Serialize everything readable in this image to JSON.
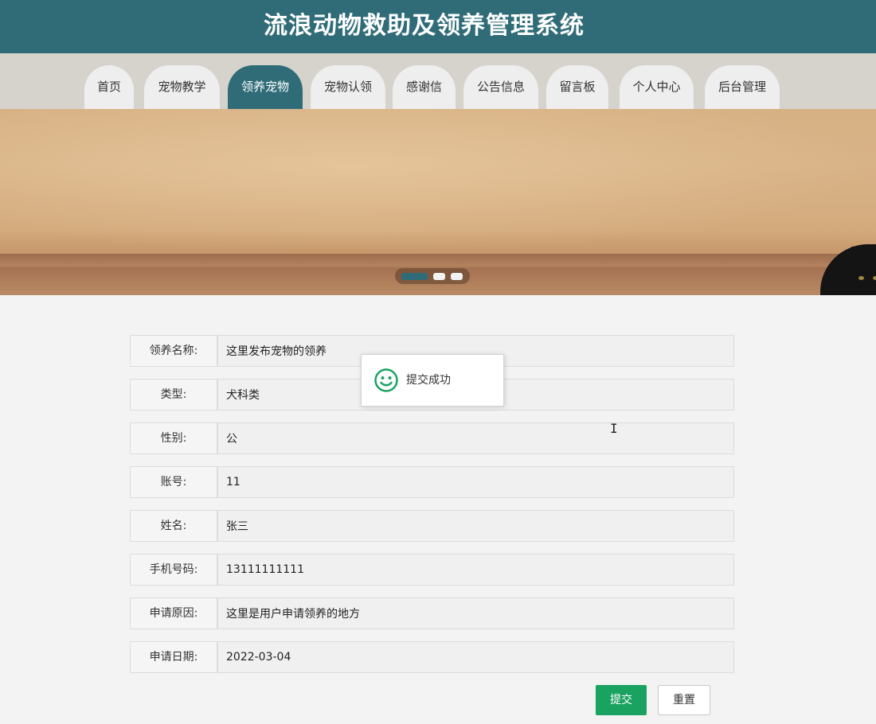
{
  "header": {
    "title": "流浪动物救助及领养管理系统"
  },
  "nav": {
    "items": [
      {
        "label": "首页"
      },
      {
        "label": "宠物教学"
      },
      {
        "label": "领养宠物"
      },
      {
        "label": "宠物认领"
      },
      {
        "label": "感谢信"
      },
      {
        "label": "公告信息"
      },
      {
        "label": "留言板"
      },
      {
        "label": "个人中心"
      },
      {
        "label": "后台管理"
      }
    ],
    "active_index": 2
  },
  "banner": {
    "slide_count": 3,
    "active_slide": 1
  },
  "form": {
    "fields": [
      {
        "label": "领养名称:",
        "value": "这里发布宠物的领养"
      },
      {
        "label": "类型:",
        "value": "犬科类"
      },
      {
        "label": "性别:",
        "value": "公"
      },
      {
        "label": "账号:",
        "value": "11"
      },
      {
        "label": "姓名:",
        "value": "张三"
      },
      {
        "label": "手机号码:",
        "value": "13111111111"
      },
      {
        "label": "申请原因:",
        "value": "这里是用户申请领养的地方"
      },
      {
        "label": "申请日期:",
        "value": "2022-03-04"
      }
    ],
    "submit_label": "提交",
    "reset_label": "重置"
  },
  "toast": {
    "message": "提交成功",
    "icon": "smile-icon"
  },
  "colors": {
    "primary": "#2f6c78",
    "success": "#1aa260",
    "nav_bg": "#d6d2cc",
    "tab_bg": "#eeeeee"
  }
}
